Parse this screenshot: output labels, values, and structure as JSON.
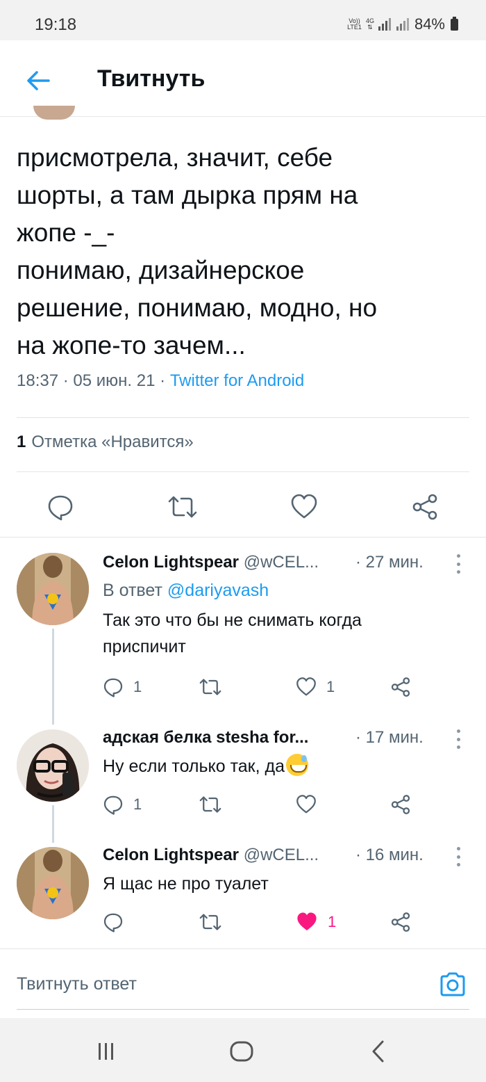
{
  "status_bar": {
    "time": "19:18",
    "volte_label": "Vo))",
    "lte_label": "LTE1",
    "net_label": "4G",
    "battery": "84%"
  },
  "header": {
    "title": "Твитнуть"
  },
  "tweet": {
    "text": "присмотрела, значит, себе\nшорты, а там дырка прям на\nжопе -_-\nпонимаю, дизайнерское\nрешение, понимаю, модно, но\nна жопе-то зачем...",
    "time": "18:37",
    "date": "05 июн. 21",
    "separator": "·",
    "source": "Twitter for Android",
    "likes_count": "1",
    "likes_label": "Отметка «Нравится»"
  },
  "replies": [
    {
      "name": "Celon Lightspear",
      "handle": "@wCEL...",
      "time": "· 27 мин.",
      "reply_to_prefix": "В ответ",
      "reply_to_mention": "@dariyavash",
      "text": "Так это что бы не снимать когда\nприспичит",
      "reply_count": "1",
      "like_count": "1",
      "liked": false
    },
    {
      "name": "адская белка stesha for...",
      "handle": "",
      "time": "· 17 мин.",
      "text": "Ну если только так, да",
      "reply_count": "1",
      "like_count": "",
      "liked": false
    },
    {
      "name": "Celon Lightspear",
      "handle": "@wCEL...",
      "time": "· 16 мин.",
      "text": "Я щас не про туалет",
      "reply_count": "",
      "like_count": "1",
      "liked": true
    }
  ],
  "compose": {
    "placeholder": "Твитнуть ответ"
  },
  "icons": {
    "back": "arrow-left-icon",
    "reply": "speech-bubble-icon",
    "retweet": "retweet-icon",
    "like": "heart-icon",
    "share": "share-icon",
    "more": "more-vertical-icon",
    "camera": "camera-icon",
    "emoji": "grinning-sweat-emoji"
  },
  "colors": {
    "accent": "#1d9bf0",
    "like_active": "#f91880",
    "muted": "#536471"
  }
}
